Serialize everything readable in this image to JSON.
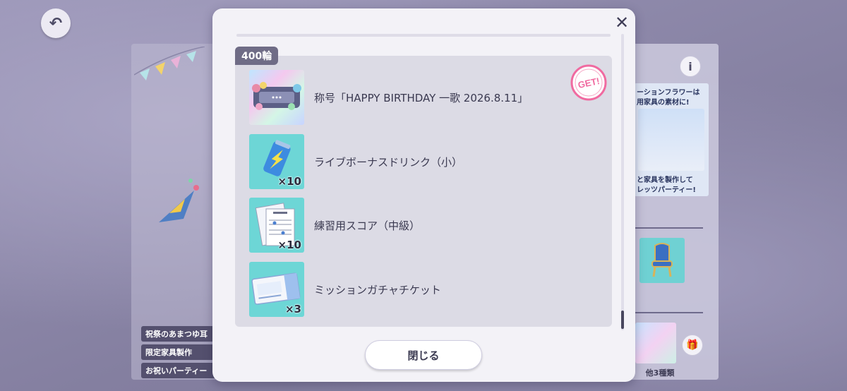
{
  "modal": {
    "tier_label": "400輪",
    "get_badge_text": "GET!",
    "close_button_label": "閉じる",
    "items": [
      {
        "name": "称号「HAPPY BIRTHDAY 一歌 2026.8.11」",
        "quantity": "",
        "icon": "title-plate-icon"
      },
      {
        "name": "ライブボーナスドリンク（小）",
        "quantity": "×10",
        "icon": "energy-drink-icon"
      },
      {
        "name": "練習用スコア（中級）",
        "quantity": "×10",
        "icon": "practice-score-icon"
      },
      {
        "name": "ミッションガチャチケット",
        "quantity": "×3",
        "icon": "gacha-ticket-icon"
      }
    ]
  },
  "background": {
    "left_labels": [
      "祝祭のあまつゆ耳",
      "限定家具製作",
      "お祝いパーティー"
    ],
    "promo": {
      "line1": "ーションフラワーは",
      "line2": "用家具の素材に!",
      "line3": "と家具を製作して",
      "line4": "レッツパーティー!"
    },
    "others_label": "他3種類",
    "info_label": "i"
  },
  "colors": {
    "accent_pink": "#f06aa0",
    "tab_gray": "#6f6c86",
    "thumb_teal": "#6dd6d6"
  }
}
